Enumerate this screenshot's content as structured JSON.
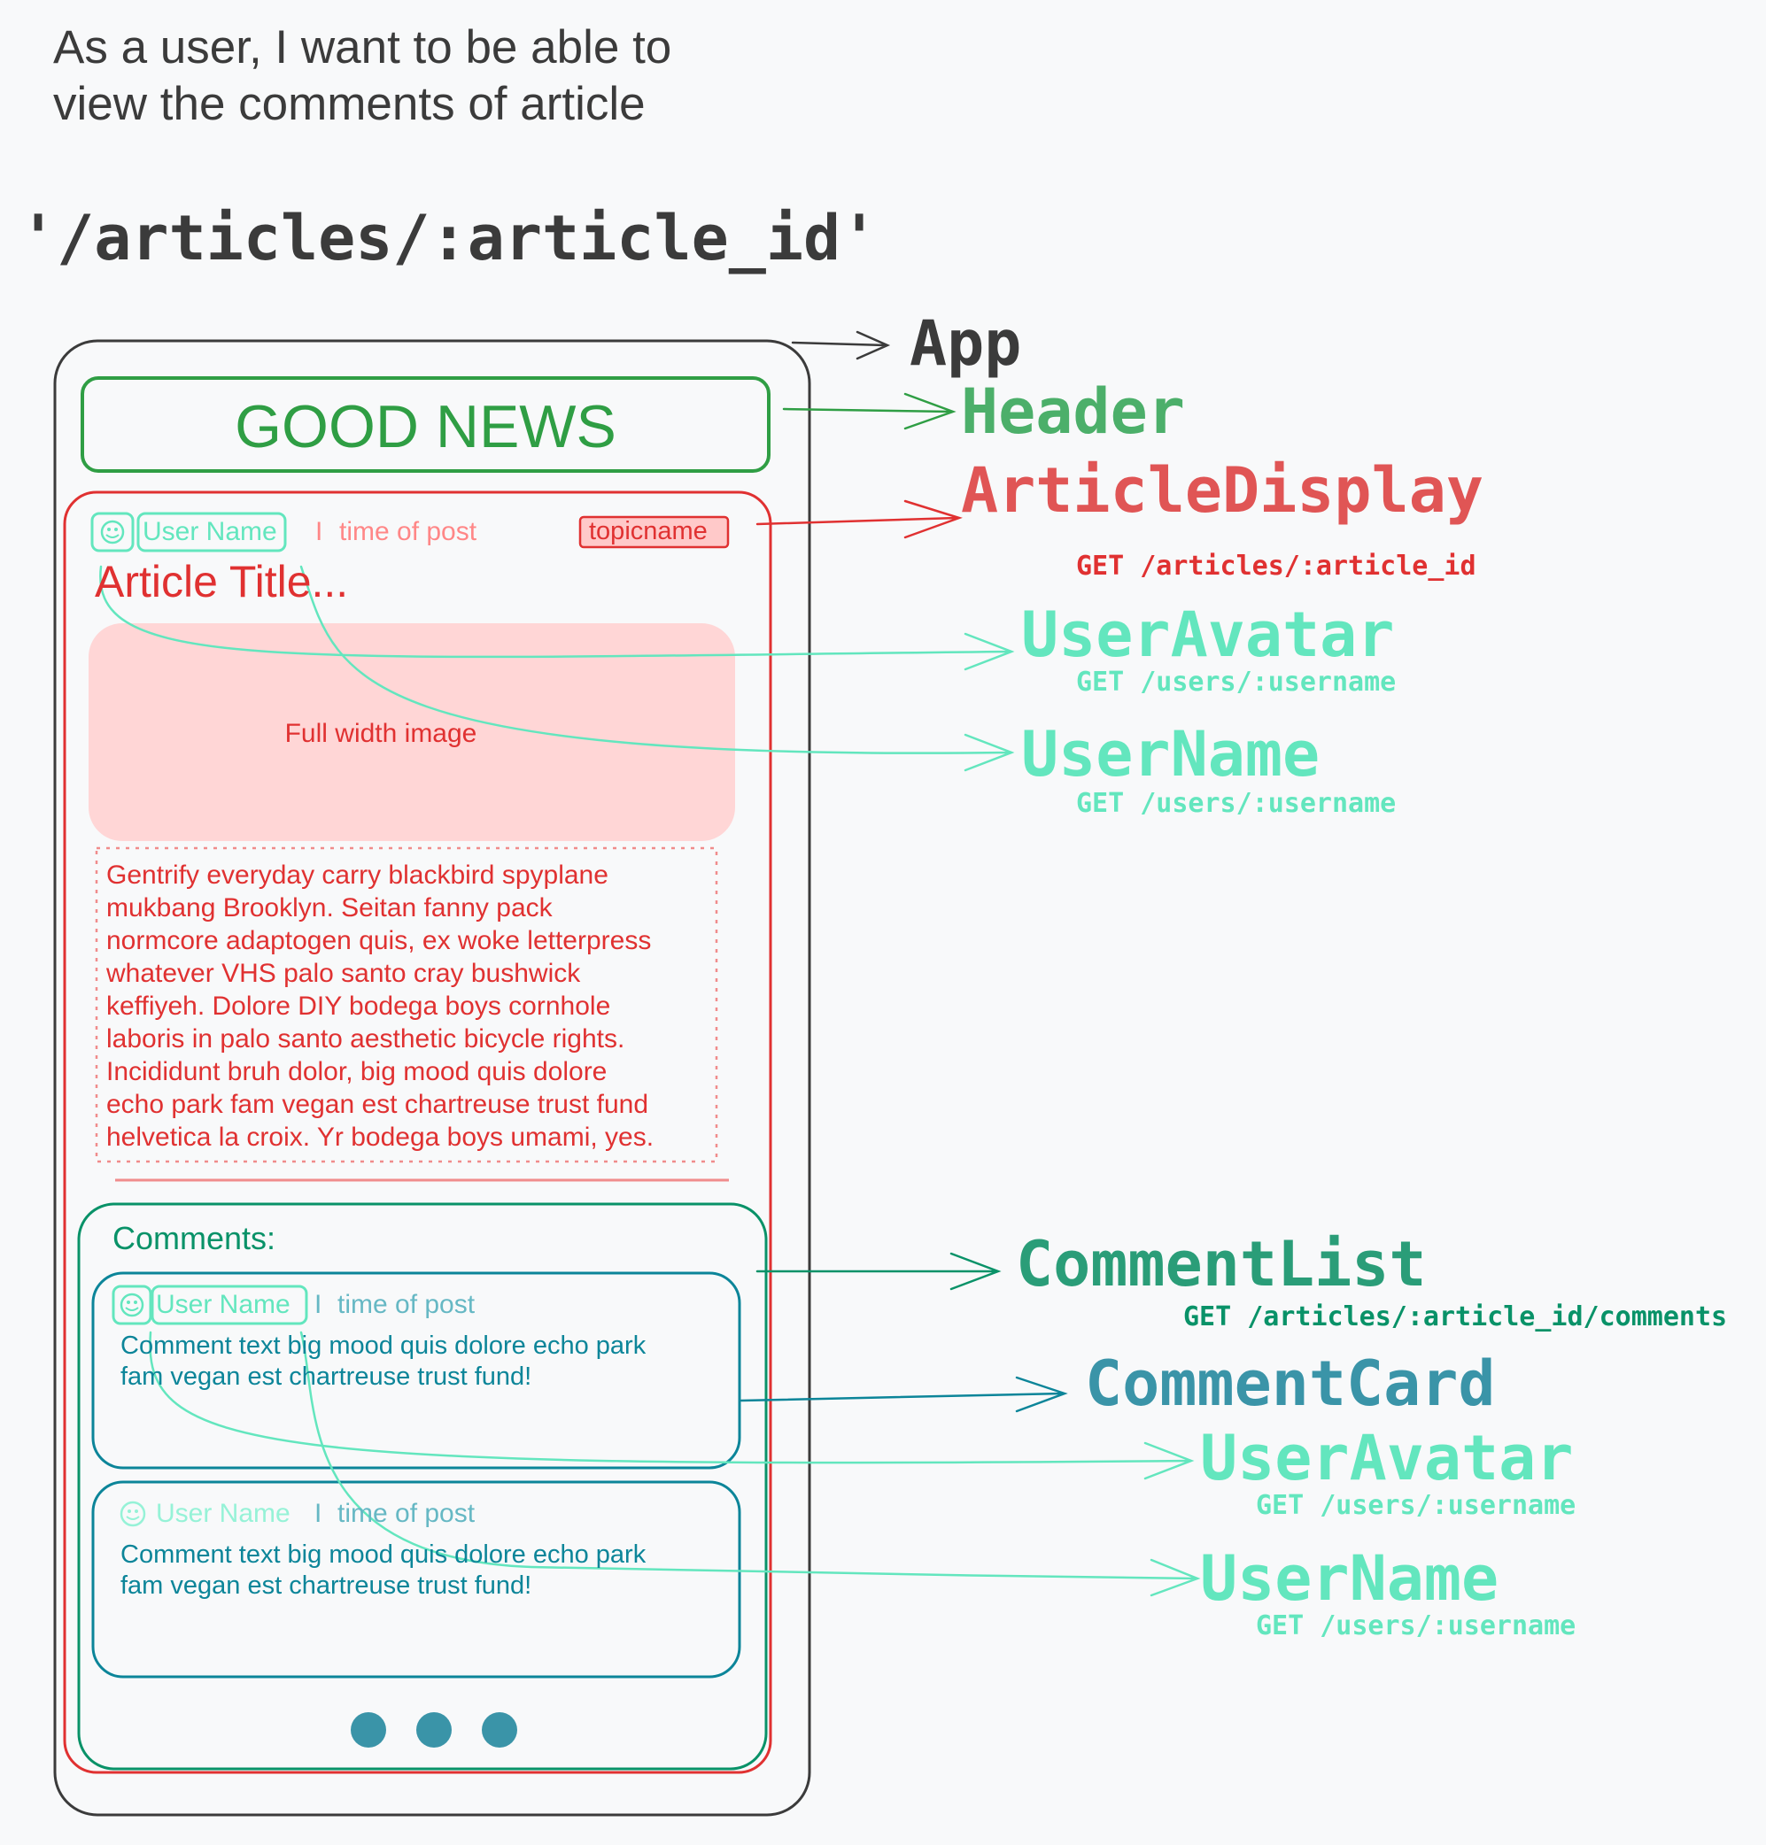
{
  "story": {
    "line1": "As a user, I want to be able to",
    "line2": "view the comments of article"
  },
  "route": "'/articles/:article_id'",
  "mockup": {
    "header_title": "GOOD NEWS",
    "article": {
      "user_name": "User Name",
      "separator": "I",
      "time": "time of post",
      "topic": "topicname",
      "title": "Article Title...",
      "image_label": "Full width image",
      "body_lines": [
        "Gentrify everyday carry blackbird spyplane",
        "mukbang Brooklyn. Seitan fanny pack",
        "normcore adaptogen quis, ex woke letterpress",
        "whatever VHS palo santo cray bushwick",
        "keffiyeh. Dolore DIY bodega boys cornhole",
        "laboris in palo santo aesthetic bicycle rights.",
        "Incididunt bruh dolor, big mood quis dolore",
        "echo park fam vegan est chartreuse trust fund",
        "helvetica la croix. Yr bodega boys umami, yes."
      ]
    },
    "comments_heading": "Comments:",
    "comments": [
      {
        "user_name": "User Name",
        "separator": "I",
        "time": "time of post",
        "text_line1": "Comment text big mood quis dolore echo park",
        "text_line2": "fam vegan est chartreuse trust fund!"
      },
      {
        "user_name": "User Name",
        "separator": "I",
        "time": "time of post",
        "text_line1": "Comment text big mood quis dolore echo park",
        "text_line2": "fam vegan est chartreuse trust fund!"
      }
    ]
  },
  "components": {
    "app": "App",
    "header": "Header",
    "article_display": "ArticleDisplay",
    "article_display_api": "GET /articles/:article_id",
    "user_avatar": "UserAvatar",
    "user_avatar_api": "GET /users/:username",
    "user_name": "UserName",
    "user_name_api": "GET /users/:username",
    "comment_list": "CommentList",
    "comment_list_api": "GET /articles/:article_id/comments",
    "comment_card": "CommentCard",
    "comment_user_avatar": "UserAvatar",
    "comment_user_avatar_api": "GET /users/:username",
    "comment_user_name": "UserName",
    "comment_user_name_api": "GET /users/:username"
  },
  "colors": {
    "app": "#3b3b3b",
    "header": "#2f9e44",
    "article": "#e03131",
    "user": "#63e6be",
    "comment_list": "#099268",
    "comment_card": "#0c8599",
    "image_fill": "#ffd6d6"
  }
}
